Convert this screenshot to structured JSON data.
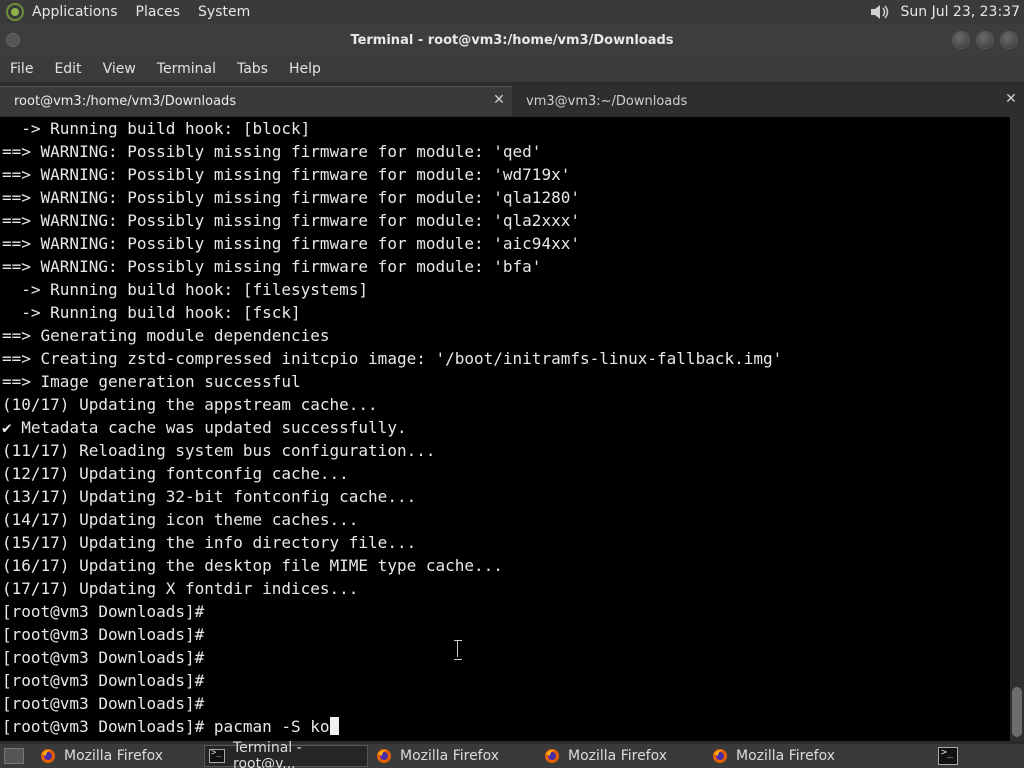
{
  "top_panel": {
    "menus": [
      "Applications",
      "Places",
      "System"
    ],
    "clock": "Sun Jul 23, 23:37",
    "icons": {
      "logo": "distro-logo-icon",
      "volume": "speaker-icon"
    }
  },
  "window": {
    "title": "Terminal - root@vm3:/home/vm3/Downloads"
  },
  "menubar": {
    "items": [
      "File",
      "Edit",
      "View",
      "Terminal",
      "Tabs",
      "Help"
    ]
  },
  "tabs": [
    {
      "label": "root@vm3:/home/vm3/Downloads",
      "active": true
    },
    {
      "label": "vm3@vm3:~/Downloads",
      "active": false
    }
  ],
  "terminal": {
    "lines": [
      "  -> Running build hook: [block]",
      "==> WARNING: Possibly missing firmware for module: 'qed'",
      "==> WARNING: Possibly missing firmware for module: 'wd719x'",
      "==> WARNING: Possibly missing firmware for module: 'qla1280'",
      "==> WARNING: Possibly missing firmware for module: 'qla2xxx'",
      "==> WARNING: Possibly missing firmware for module: 'aic94xx'",
      "==> WARNING: Possibly missing firmware for module: 'bfa'",
      "  -> Running build hook: [filesystems]",
      "  -> Running build hook: [fsck]",
      "==> Generating module dependencies",
      "==> Creating zstd-compressed initcpio image: '/boot/initramfs-linux-fallback.img'",
      "==> Image generation successful",
      "(10/17) Updating the appstream cache...",
      "✔ Metadata cache was updated successfully.",
      "(11/17) Reloading system bus configuration...",
      "(12/17) Updating fontconfig cache...",
      "(13/17) Updating 32-bit fontconfig cache...",
      "(14/17) Updating icon theme caches...",
      "(15/17) Updating the info directory file...",
      "(16/17) Updating the desktop file MIME type cache...",
      "(17/17) Updating X fontdir indices...",
      "[root@vm3 Downloads]#",
      "[root@vm3 Downloads]#",
      "[root@vm3 Downloads]#",
      "[root@vm3 Downloads]#",
      "[root@vm3 Downloads]#"
    ],
    "prompt": "[root@vm3 Downloads]# ",
    "command": "pacman -S ko"
  },
  "taskbar": {
    "items": [
      {
        "label": "Mozilla Firefox",
        "icon": "firefox-icon",
        "active": false
      },
      {
        "label": "Terminal - root@v...",
        "icon": "terminal-icon",
        "active": true
      },
      {
        "label": "Mozilla Firefox",
        "icon": "firefox-icon",
        "active": false
      },
      {
        "label": "Mozilla Firefox",
        "icon": "firefox-icon",
        "active": false
      },
      {
        "label": "Mozilla Firefox",
        "icon": "firefox-icon",
        "active": false
      }
    ]
  }
}
